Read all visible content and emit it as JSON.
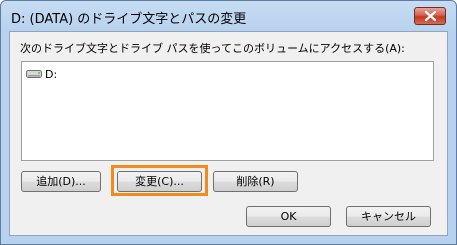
{
  "window": {
    "title": "D: (DATA) のドライブ文字とパスの変更"
  },
  "dialog": {
    "instruction": "次のドライブ文字とドライブ パスを使ってこのボリュームにアクセスする(A):",
    "list_items": [
      {
        "label": "D:",
        "icon": "drive-icon"
      }
    ],
    "buttons": {
      "add": "追加(D)...",
      "change": "変更(C)...",
      "remove": "削除(R)",
      "ok": "OK",
      "cancel": "キャンセル"
    }
  },
  "colors": {
    "highlight": "#f28a1d",
    "title_gradient_top": "#c6dcf3",
    "close_button": "#c23a22"
  }
}
